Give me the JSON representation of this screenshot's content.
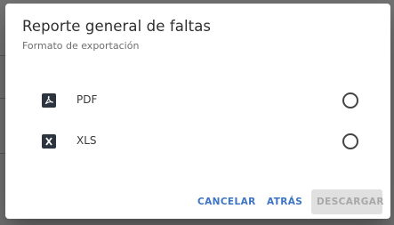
{
  "dialog": {
    "title": "Reporte general de faltas",
    "subtitle": "Formato de exportación",
    "options": [
      {
        "label": "PDF",
        "icon": "pdf-file-icon",
        "selected": false
      },
      {
        "label": "XLS",
        "icon": "excel-file-icon",
        "selected": false
      }
    ],
    "buttons": {
      "cancel": "CANCELAR",
      "back": "ATRÁS",
      "download": "DESCARGAR"
    }
  },
  "colors": {
    "accent": "#3d74c4",
    "icon_bg": "#2c3440",
    "disabled_bg": "#e0e0e0"
  }
}
